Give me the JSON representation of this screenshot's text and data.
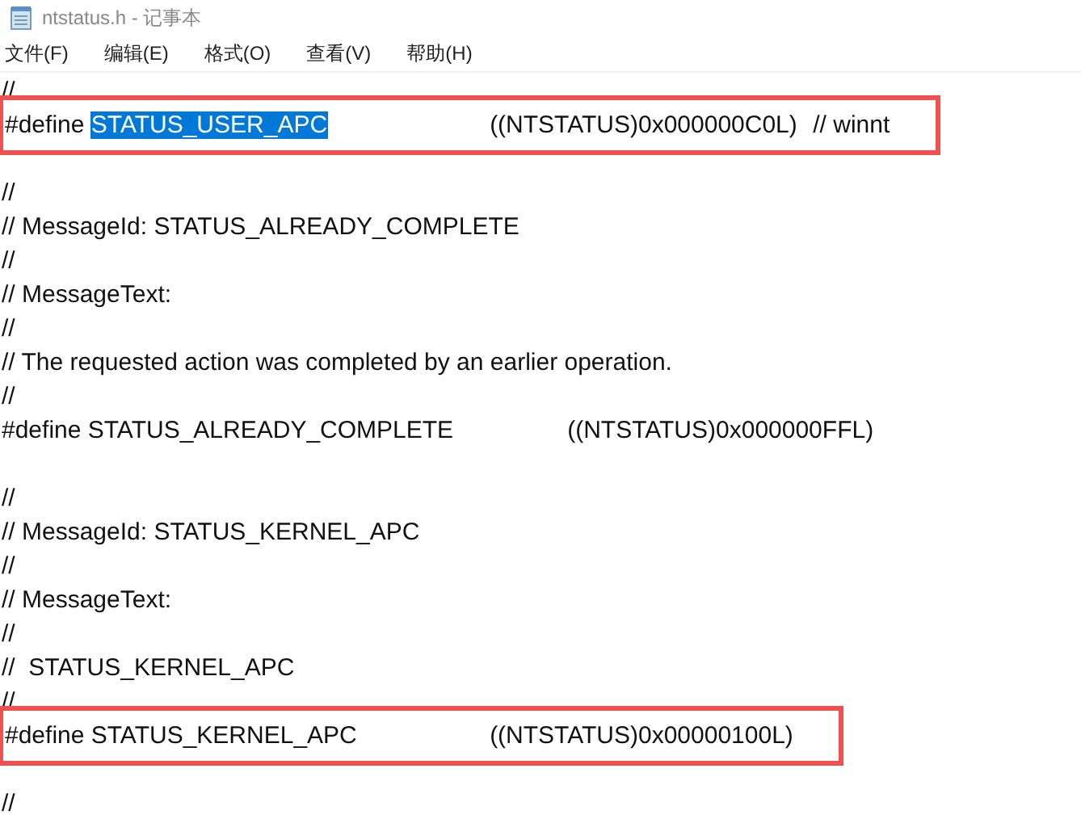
{
  "window": {
    "title": "ntstatus.h - 记事本"
  },
  "menu": [
    {
      "label": "文件(F)"
    },
    {
      "label": "编辑(E)"
    },
    {
      "label": "格式(O)"
    },
    {
      "label": "查看(V)"
    },
    {
      "label": "帮助(H)"
    }
  ],
  "lines": [
    {
      "kind": "text",
      "boxed": false,
      "segments": [
        {
          "text": "//",
          "selected": false
        }
      ]
    },
    {
      "kind": "text",
      "boxed": true,
      "segments": [
        {
          "text": "#define ",
          "selected": false
        },
        {
          "text": "STATUS_USER_APC",
          "selected": true
        },
        {
          "text": "\t\t((NTSTATUS)0x000000C0L)\t// winnt",
          "selected": false
        }
      ]
    },
    {
      "kind": "blank"
    },
    {
      "kind": "text",
      "boxed": false,
      "segments": [
        {
          "text": "//",
          "selected": false
        }
      ]
    },
    {
      "kind": "text",
      "boxed": false,
      "segments": [
        {
          "text": "// MessageId: STATUS_ALREADY_COMPLETE",
          "selected": false
        }
      ]
    },
    {
      "kind": "text",
      "boxed": false,
      "segments": [
        {
          "text": "//",
          "selected": false
        }
      ]
    },
    {
      "kind": "text",
      "boxed": false,
      "segments": [
        {
          "text": "// MessageText:",
          "selected": false
        }
      ]
    },
    {
      "kind": "text",
      "boxed": false,
      "segments": [
        {
          "text": "//",
          "selected": false
        }
      ]
    },
    {
      "kind": "text",
      "boxed": false,
      "segments": [
        {
          "text": "// The requested action was completed by an earlier operation.",
          "selected": false
        }
      ]
    },
    {
      "kind": "text",
      "boxed": false,
      "segments": [
        {
          "text": "//",
          "selected": false
        }
      ]
    },
    {
      "kind": "text",
      "boxed": false,
      "segments": [
        {
          "text": "#define STATUS_ALREADY_COMPLETE\t\t((NTSTATUS)0x000000FFL)",
          "selected": false
        }
      ]
    },
    {
      "kind": "blank"
    },
    {
      "kind": "text",
      "boxed": false,
      "segments": [
        {
          "text": "//",
          "selected": false
        }
      ]
    },
    {
      "kind": "text",
      "boxed": false,
      "segments": [
        {
          "text": "// MessageId: STATUS_KERNEL_APC",
          "selected": false
        }
      ]
    },
    {
      "kind": "text",
      "boxed": false,
      "segments": [
        {
          "text": "//",
          "selected": false
        }
      ]
    },
    {
      "kind": "text",
      "boxed": false,
      "segments": [
        {
          "text": "// MessageText:",
          "selected": false
        }
      ]
    },
    {
      "kind": "text",
      "boxed": false,
      "segments": [
        {
          "text": "//",
          "selected": false
        }
      ]
    },
    {
      "kind": "text",
      "boxed": false,
      "segments": [
        {
          "text": "//  STATUS_KERNEL_APC",
          "selected": false
        }
      ]
    },
    {
      "kind": "text",
      "boxed": false,
      "segments": [
        {
          "text": "//",
          "selected": false
        }
      ]
    },
    {
      "kind": "text",
      "boxed": true,
      "segments": [
        {
          "text": "#define STATUS_KERNEL_APC\t\t((NTSTATUS)0x00000100L)",
          "selected": false
        }
      ]
    },
    {
      "kind": "blank"
    },
    {
      "kind": "text",
      "boxed": false,
      "segments": [
        {
          "text": "//",
          "selected": false
        }
      ]
    }
  ]
}
